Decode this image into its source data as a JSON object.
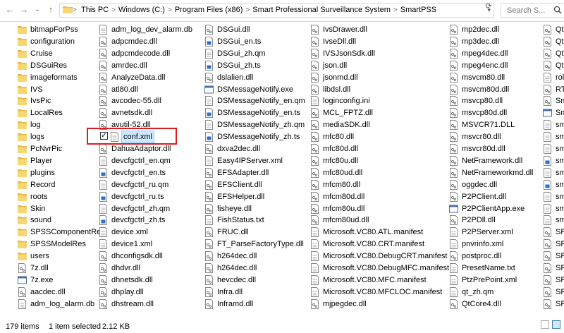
{
  "nav": {
    "back": "←",
    "forward": "→",
    "dropdown": "⌄",
    "up": "↑"
  },
  "address": {
    "crumbs": [
      "This PC",
      "Windows (C:)",
      "Program Files (x86)",
      "Smart Professional Surveillance System",
      "SmartPSS"
    ],
    "separator": ">"
  },
  "search": {
    "placeholder": "Search S..."
  },
  "selected_file": "conf.xml",
  "columns": [
    {
      "items": [
        {
          "name": "bitmapForPss",
          "type": "folder"
        },
        {
          "name": "configuration",
          "type": "folder"
        },
        {
          "name": "Cruise",
          "type": "folder"
        },
        {
          "name": "DSGuiRes",
          "type": "folder"
        },
        {
          "name": "imageformats",
          "type": "folder"
        },
        {
          "name": "IVS",
          "type": "folder"
        },
        {
          "name": "IvsPic",
          "type": "folder"
        },
        {
          "name": "LocalRes",
          "type": "folder"
        },
        {
          "name": "log",
          "type": "folder"
        },
        {
          "name": "logs",
          "type": "folder"
        },
        {
          "name": "PcNvrPic",
          "type": "folder"
        },
        {
          "name": "Player",
          "type": "folder"
        },
        {
          "name": "plugins",
          "type": "folder"
        },
        {
          "name": "Record",
          "type": "folder"
        },
        {
          "name": "roots",
          "type": "folder"
        },
        {
          "name": "Skin",
          "type": "folder"
        },
        {
          "name": "sound",
          "type": "folder"
        },
        {
          "name": "SPSSComponentRes",
          "type": "folder"
        },
        {
          "name": "SPSSModelRes",
          "type": "folder"
        },
        {
          "name": "users",
          "type": "folder"
        },
        {
          "name": "7z.dll",
          "type": "dll"
        },
        {
          "name": "7z.exe",
          "type": "exe"
        },
        {
          "name": "aacdec.dll",
          "type": "dll"
        },
        {
          "name": "adm_log_alarm.db",
          "type": "file"
        }
      ]
    },
    {
      "items": [
        {
          "name": "adm_log_dev_alarm.db",
          "type": "file"
        },
        {
          "name": "adpcmdec.dll",
          "type": "dll"
        },
        {
          "name": "adpcmdecode.dll",
          "type": "dll"
        },
        {
          "name": "amrdec.dll",
          "type": "dll"
        },
        {
          "name": "AnalyzeData.dll",
          "type": "dll"
        },
        {
          "name": "atl80.dll",
          "type": "dll"
        },
        {
          "name": "avcodec-55.dll",
          "type": "dll"
        },
        {
          "name": "avnetsdk.dll",
          "type": "dll"
        },
        {
          "name": "avutil-52.dll",
          "type": "dll"
        },
        {
          "name": "conf.xml",
          "type": "file"
        },
        {
          "name": "DahuaAdaptor.dll",
          "type": "dll"
        },
        {
          "name": "devcfgctrl_en.qm",
          "type": "file"
        },
        {
          "name": "devcfgctrl_en.ts",
          "type": "ts"
        },
        {
          "name": "devcfgctrl_ru.qm",
          "type": "file"
        },
        {
          "name": "devcfgctrl_ru.ts",
          "type": "ts"
        },
        {
          "name": "devcfgctrl_zh.qm",
          "type": "file"
        },
        {
          "name": "devcfgctrl_zh.ts",
          "type": "ts"
        },
        {
          "name": "device.xml",
          "type": "file"
        },
        {
          "name": "device1.xml",
          "type": "file"
        },
        {
          "name": "dhconfigsdk.dll",
          "type": "dll"
        },
        {
          "name": "dhdvr.dll",
          "type": "dll"
        },
        {
          "name": "dhnetsdk.dll",
          "type": "dll"
        },
        {
          "name": "dhplay.dll",
          "type": "dll"
        },
        {
          "name": "dhstream.dll",
          "type": "dll"
        }
      ]
    },
    {
      "items": [
        {
          "name": "DSGui.dll",
          "type": "dll"
        },
        {
          "name": "DSGui_en.ts",
          "type": "ts"
        },
        {
          "name": "DSGui_zh.qm",
          "type": "file"
        },
        {
          "name": "DSGui_zh.ts",
          "type": "ts"
        },
        {
          "name": "dslalien.dll",
          "type": "dll"
        },
        {
          "name": "DSMessageNotify.exe",
          "type": "exe"
        },
        {
          "name": "DSMessageNotify_en.qm",
          "type": "file"
        },
        {
          "name": "DSMessageNotify_en.ts",
          "type": "ts"
        },
        {
          "name": "DSMessageNotify_zh.qm",
          "type": "file"
        },
        {
          "name": "DSMessageNotify_zh.ts",
          "type": "ts"
        },
        {
          "name": "dxva2dec.dll",
          "type": "dll"
        },
        {
          "name": "Easy4IPServer.xml",
          "type": "file"
        },
        {
          "name": "EFSAdapter.dll",
          "type": "dll"
        },
        {
          "name": "EFSClient.dll",
          "type": "dll"
        },
        {
          "name": "EFSHelper.dll",
          "type": "dll"
        },
        {
          "name": "fisheye.dll",
          "type": "dll"
        },
        {
          "name": "FishStatus.txt",
          "type": "file"
        },
        {
          "name": "FRUC.dll",
          "type": "dll"
        },
        {
          "name": "FT_ParseFactoryType.dll",
          "type": "dll"
        },
        {
          "name": "h264dec.dll",
          "type": "dll"
        },
        {
          "name": "h264dec.dll",
          "type": "dll"
        },
        {
          "name": "hevcdec.dll",
          "type": "dll"
        },
        {
          "name": "Infra.dll",
          "type": "dll"
        },
        {
          "name": "Inframd.dll",
          "type": "dll"
        }
      ]
    },
    {
      "items": [
        {
          "name": "IvsDrawer.dll",
          "type": "dll"
        },
        {
          "name": "IvseDll.dll",
          "type": "dll"
        },
        {
          "name": "IVSJsonSdk.dll",
          "type": "dll"
        },
        {
          "name": "json.dll",
          "type": "dll"
        },
        {
          "name": "jsonmd.dll",
          "type": "dll"
        },
        {
          "name": "libdsl.dll",
          "type": "dll"
        },
        {
          "name": "loginconfig.ini",
          "type": "file"
        },
        {
          "name": "MCL_FPTZ.dll",
          "type": "dll"
        },
        {
          "name": "mediaSDK.dll",
          "type": "dll"
        },
        {
          "name": "mfc80.dll",
          "type": "dll"
        },
        {
          "name": "mfc80d.dll",
          "type": "dll"
        },
        {
          "name": "mfc80u.dll",
          "type": "dll"
        },
        {
          "name": "mfc80ud.dll",
          "type": "dll"
        },
        {
          "name": "mfcm80.dll",
          "type": "dll"
        },
        {
          "name": "mfcm80d.dll",
          "type": "dll"
        },
        {
          "name": "mfcm80u.dll",
          "type": "dll"
        },
        {
          "name": "mfcm80ud.dll",
          "type": "dll"
        },
        {
          "name": "Microsoft.VC80.ATL.manifest",
          "type": "file"
        },
        {
          "name": "Microsoft.VC80.CRT.manifest",
          "type": "file"
        },
        {
          "name": "Microsoft.VC80.DebugCRT.manifest",
          "type": "file"
        },
        {
          "name": "Microsoft.VC80.DebugMFC.manifest",
          "type": "file"
        },
        {
          "name": "Microsoft.VC80.MFC.manifest",
          "type": "file"
        },
        {
          "name": "Microsoft.VC80.MFCLOC.manifest",
          "type": "file"
        },
        {
          "name": "mjpegdec.dll",
          "type": "dll"
        }
      ]
    },
    {
      "items": [
        {
          "name": "mp2dec.dll",
          "type": "dll"
        },
        {
          "name": "mp3dec.dll",
          "type": "dll"
        },
        {
          "name": "mpeg4dec.dll",
          "type": "dll"
        },
        {
          "name": "mpeg4enc.dll",
          "type": "dll"
        },
        {
          "name": "msvcm80.dll",
          "type": "dll"
        },
        {
          "name": "msvcm80d.dll",
          "type": "dll"
        },
        {
          "name": "msvcp80.dll",
          "type": "dll"
        },
        {
          "name": "msvcp80d.dll",
          "type": "dll"
        },
        {
          "name": "MSVCR71.DLL",
          "type": "dll"
        },
        {
          "name": "msvcr80.dll",
          "type": "dll"
        },
        {
          "name": "msvcr80d.dll",
          "type": "dll"
        },
        {
          "name": "NetFramework.dll",
          "type": "dll"
        },
        {
          "name": "NetFrameworkmd.dll",
          "type": "dll"
        },
        {
          "name": "oggdec.dll",
          "type": "dll"
        },
        {
          "name": "P2PClient.dll",
          "type": "dll"
        },
        {
          "name": "P2PClientApp.exe",
          "type": "exe"
        },
        {
          "name": "P2PDll.dll",
          "type": "dll"
        },
        {
          "name": "P2PServer.xml",
          "type": "file"
        },
        {
          "name": "pnvrinfo.xml",
          "type": "file"
        },
        {
          "name": "postproc.dll",
          "type": "dll"
        },
        {
          "name": "PresetName.txt",
          "type": "file"
        },
        {
          "name": "PtzPrePoint.xml",
          "type": "file"
        },
        {
          "name": "qt_zh.qm",
          "type": "file"
        },
        {
          "name": "QtCore4.dll",
          "type": "dll"
        }
      ]
    },
    {
      "items": [
        {
          "name": "QtG",
          "type": "dll"
        },
        {
          "name": "QtN",
          "type": "dll"
        },
        {
          "name": "QtW",
          "type": "dll"
        },
        {
          "name": "QtX",
          "type": "dll"
        },
        {
          "name": "role",
          "type": "file"
        },
        {
          "name": "RTP",
          "type": "dll"
        },
        {
          "name": "Sma",
          "type": "dll"
        },
        {
          "name": "Sma",
          "type": "exe"
        },
        {
          "name": "sma",
          "type": "file"
        },
        {
          "name": "sma",
          "type": "file"
        },
        {
          "name": "sma",
          "type": "file"
        },
        {
          "name": "sma",
          "type": "ts"
        },
        {
          "name": "sma",
          "type": "file"
        },
        {
          "name": "sma",
          "type": "ts"
        },
        {
          "name": "sma",
          "type": "file"
        },
        {
          "name": "sma",
          "type": "file"
        },
        {
          "name": "sma",
          "type": "file"
        },
        {
          "name": "SPS",
          "type": "dll"
        },
        {
          "name": "SPS",
          "type": "dll"
        },
        {
          "name": "SPS",
          "type": "dll"
        },
        {
          "name": "SPS",
          "type": "dll"
        },
        {
          "name": "SPS",
          "type": "dll"
        },
        {
          "name": "SPS",
          "type": "dll"
        },
        {
          "name": "SPS",
          "type": "dll"
        }
      ]
    }
  ],
  "status": {
    "item_count": "179 items",
    "selection": "1 item selected",
    "size": "2.12 KB"
  }
}
